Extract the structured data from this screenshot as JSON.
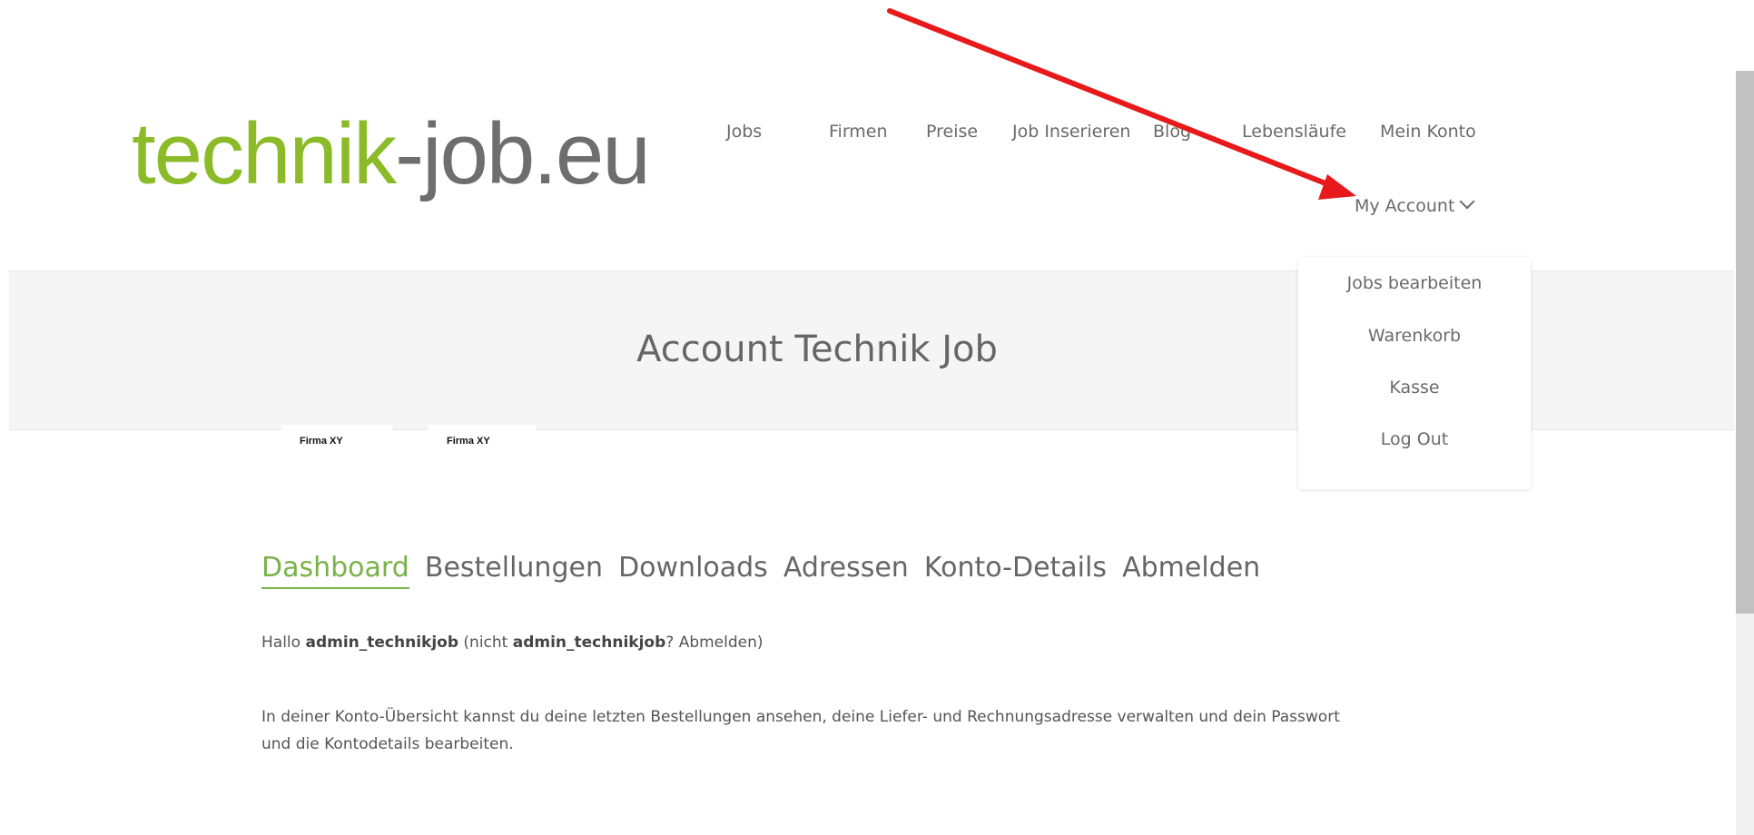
{
  "logo": {
    "green": "technik",
    "dark": "-job.eu"
  },
  "topnav": [
    "Jobs",
    "Firmen",
    "Preise",
    "Job Inserieren",
    "Blog",
    "Lebensläufe",
    "Mein Konto"
  ],
  "my_account": {
    "label": "My Account"
  },
  "dropdown": [
    "Jobs bearbeiten",
    "Warenkorb",
    "Kasse",
    "Log Out"
  ],
  "page_title": "Account Technik Job",
  "firma": [
    "Firma XY",
    "Firma XY"
  ],
  "tabs": [
    "Dashboard",
    "Bestellungen",
    "Downloads",
    "Adressen",
    "Konto-Details",
    "Abmelden"
  ],
  "greeting": {
    "hallo": "Hallo",
    "user": "admin_technikjob",
    "nicht": "(nicht",
    "user2": "admin_technikjob",
    "rest": "? Abmelden)"
  },
  "intro_text": "In deiner Konto-Übersicht kannst du deine letzten Bestellungen ansehen, deine Liefer- und Rechnungsadresse verwalten und dein Passwort und die Kontodetails bearbeiten.",
  "colors": {
    "brand_green": "#8cbb2a",
    "tab_active": "#7ab24a",
    "arrow": "#e8191b"
  },
  "annotation": {
    "type": "arrow",
    "points_to": "My Account"
  }
}
